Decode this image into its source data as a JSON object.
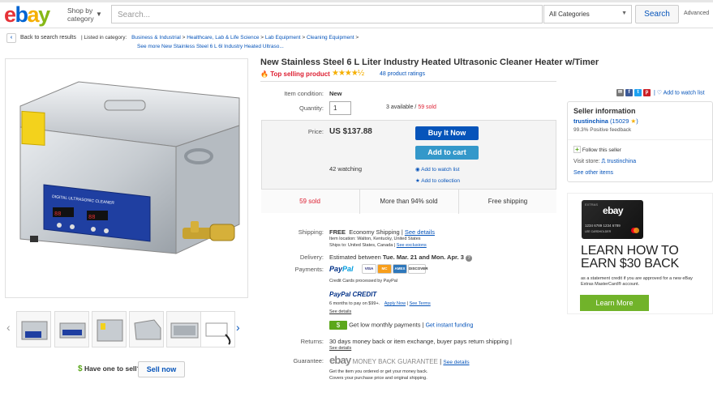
{
  "header": {
    "logo": {
      "e": "e",
      "b": "b",
      "a": "a",
      "y": "y"
    },
    "shop_by_line1": "Shop by",
    "shop_by_line2": "category",
    "search_placeholder": "Search...",
    "category_select": "All Categories",
    "search_button": "Search",
    "advanced": "Advanced"
  },
  "breadcrumb": {
    "back": "Back to search results",
    "listed_in": "| Listed in category:",
    "path": [
      "Business & Industrial",
      "Healthcare, Lab & Life Science",
      "Lab Equipment",
      "Cleaning Equipment"
    ],
    "separator": ">",
    "see_more": "See more New Stainless Steel 6 L 6l Industry Heated Ultraso..."
  },
  "product": {
    "title": "New Stainless Steel 6 L Liter Industry Heated Ultrasonic Cleaner Heater w/Timer",
    "top_selling": "Top selling product",
    "stars": "★★★★½",
    "ratings": "48 product ratings",
    "item_condition_label": "Item condition:",
    "item_condition": "New",
    "quantity_label": "Quantity:",
    "quantity_value": "1",
    "available": "3 available / ",
    "sold_inline": "59 sold",
    "price_label": "Price:",
    "price": "US $137.88",
    "buy_now": "Buy It Now",
    "add_to_cart": "Add to cart",
    "watching": "42 watching",
    "add_watch": "Add to watch list",
    "add_collection": "Add to collection",
    "stats": [
      "59 sold",
      "More than 94% sold",
      "Free shipping"
    ],
    "image_panel_text": "DIGITAL ULTRASONIC CLEANER"
  },
  "shipping": {
    "label": "Shipping:",
    "free": "FREE",
    "economy": "Economy Shipping",
    "see_details": "See details",
    "item_location": "Item location:  Walton, Kentucky, United States",
    "ships_to": "Ships to:  United States, Canada",
    "see_exclusions": "See exclusions"
  },
  "delivery": {
    "label": "Delivery:",
    "text": "Estimated between ",
    "dates": "Tue. Mar. 21 and Mon. Apr. 3"
  },
  "payments": {
    "label": "Payments:",
    "paypal_a": "Pay",
    "paypal_b": "Pal",
    "cards": [
      "VISA",
      "MC",
      "AMEX",
      "DISCOVER"
    ],
    "credit_note": "Credit Cards processed by PayPal",
    "pp_credit": "PayPal CREDIT",
    "pp_credit_line": "6 months to pay on $99+.",
    "apply_now": "Apply Now",
    "see_terms": "See Terms",
    "see_details": "See details",
    "low_monthly": "Get low monthly payments",
    "instant_funding": "Get instant funding"
  },
  "returns": {
    "label": "Returns:",
    "text": "30 days money back or item exchange, buyer pays return shipping |",
    "see_details": "See details"
  },
  "guarantee": {
    "label": "Guarantee:",
    "ebay": "ebay",
    "mbg": "MONEY BACK GUARANTEE",
    "see_details": "See details",
    "line1": "Get the item you ordered or get your money back.",
    "line2": "Covers your purchase price and original shipping."
  },
  "seller": {
    "heading": "Seller information",
    "name": "trustinchina",
    "score": "(15029",
    "score_end": ")",
    "feedback": "99.3% Positive feedback",
    "follow": "Follow this seller",
    "visit_store": "Visit store:",
    "store_name": "trustinchina",
    "other_items": "See other items"
  },
  "share": {
    "add_watch": "Add to watch list"
  },
  "ad": {
    "card_brand": "EXTRAS",
    "card_logo": "ebay",
    "card_number": "1234 6789 1234 6789",
    "card_name": "LEE CARDHOLDER",
    "headline1": "LEARN HOW TO",
    "headline2": "EARN $30 BACK",
    "sub": "as a statement credit if you are approved for a new eBay Extras MasterCard® account.",
    "button": "Learn More"
  },
  "sell": {
    "question": "Have one to sell?",
    "button": "Sell now"
  },
  "colors": {
    "ebay_red": "#e53238",
    "ebay_blue": "#0064d2",
    "ebay_yellow": "#f5af02",
    "ebay_green": "#86b817",
    "link": "#0654ba",
    "buy_now_bg": "#0654ba",
    "cart_bg": "#3498ca",
    "sold_red": "#dd1e31"
  }
}
